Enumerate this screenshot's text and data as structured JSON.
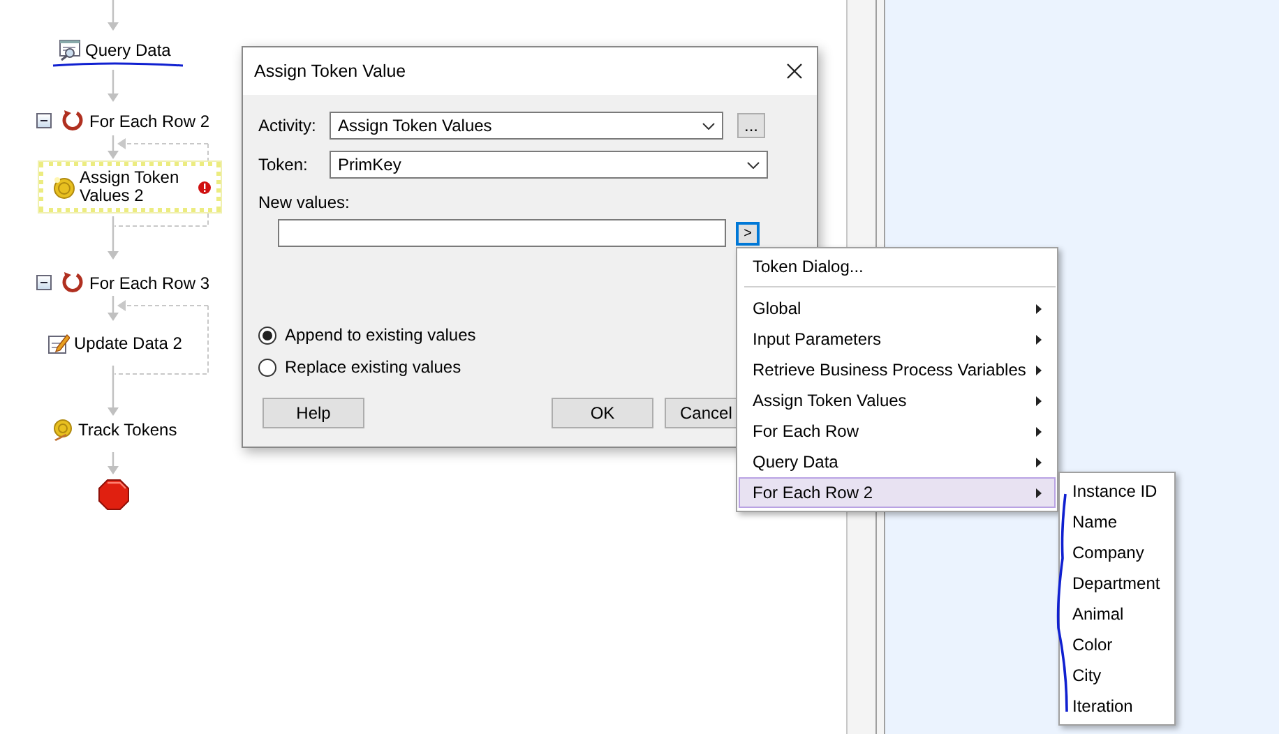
{
  "flow": {
    "nodes": [
      {
        "kind": "query",
        "label": "Query Data",
        "selected": false,
        "error": false
      },
      {
        "kind": "loop",
        "label": "For Each Row 2",
        "selected": false,
        "error": false,
        "expanded": true
      },
      {
        "kind": "assign",
        "label": "Assign Token Values 2",
        "selected": true,
        "error": true
      },
      {
        "kind": "loop",
        "label": "For Each Row 3",
        "selected": false,
        "error": false,
        "expanded": true
      },
      {
        "kind": "update",
        "label": "Update Data 2",
        "selected": false,
        "error": false
      },
      {
        "kind": "track",
        "label": "Track Tokens",
        "selected": false,
        "error": false
      },
      {
        "kind": "end",
        "selected": false,
        "error": false
      }
    ]
  },
  "dialog": {
    "title": "Assign Token Value",
    "fields": [
      {
        "label": "Activity:",
        "value": "Assign Token Values",
        "browse_button": "..."
      },
      {
        "label": "Token:",
        "value": "PrimKey"
      }
    ],
    "new_values": {
      "label": "New values:",
      "picker_button": ">"
    },
    "options": [
      {
        "label": "Append to existing values",
        "selected": true
      },
      {
        "label": "Replace existing values",
        "selected": false
      }
    ],
    "buttons": [
      "Help",
      "OK",
      "Cancel"
    ]
  },
  "context_menu": {
    "items": [
      {
        "kind": "command",
        "label": "Token Dialog...",
        "selected": false
      },
      {
        "kind": "separator"
      },
      {
        "kind": "submenu",
        "label": "Global",
        "selected": false
      },
      {
        "kind": "submenu",
        "label": "Input Parameters",
        "selected": false
      },
      {
        "kind": "submenu",
        "label": "Retrieve Business Process Variables",
        "selected": false
      },
      {
        "kind": "submenu",
        "label": "Assign Token Values",
        "selected": false
      },
      {
        "kind": "submenu",
        "label": "For Each Row",
        "selected": false
      },
      {
        "kind": "submenu",
        "label": "Query Data",
        "selected": false
      },
      {
        "kind": "submenu",
        "label": "For Each Row 2",
        "selected": true
      }
    ]
  },
  "submenu": {
    "items": [
      "Instance ID",
      "Name",
      "Company",
      "Department",
      "Animal",
      "Color",
      "City",
      "Iteration"
    ]
  }
}
